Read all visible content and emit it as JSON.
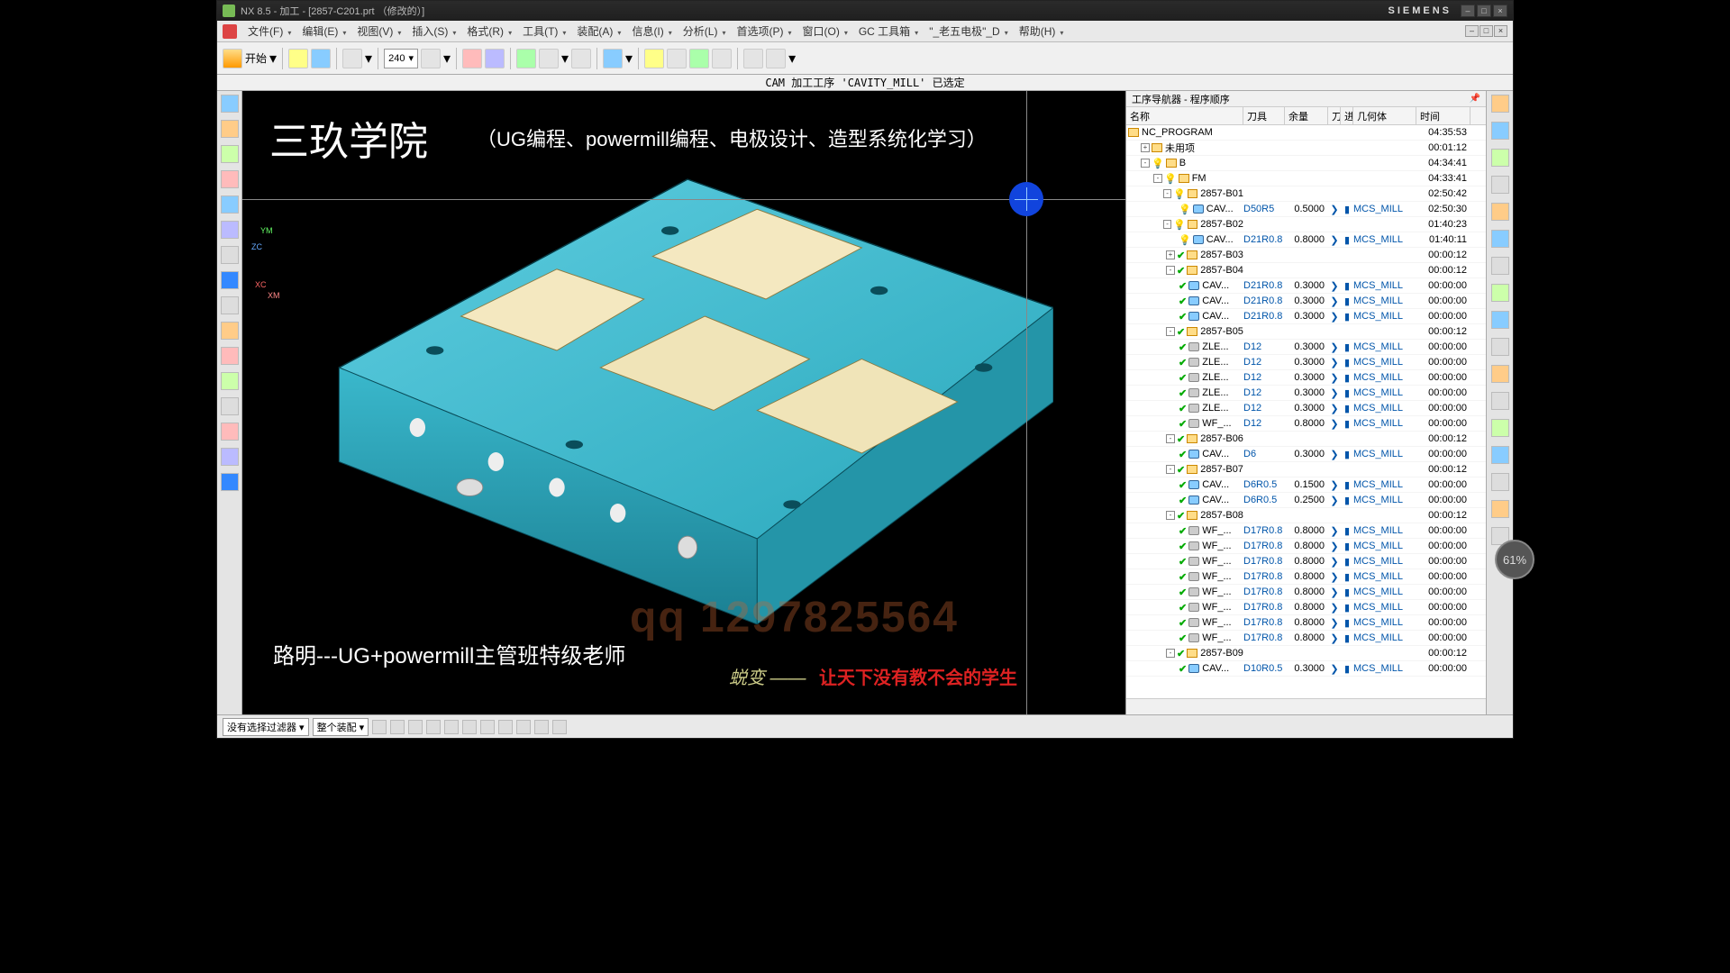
{
  "title": "NX 8.5 - 加工 - [2857-C201.prt （修改的）]",
  "brand": "SIEMENS",
  "menus": [
    "文件(F)",
    "编辑(E)",
    "视图(V)",
    "插入(S)",
    "格式(R)",
    "工具(T)",
    "装配(A)",
    "信息(I)",
    "分析(L)",
    "首选项(P)",
    "窗口(O)",
    "GC 工具箱",
    "\"_老五电极\"_D",
    "帮助(H)"
  ],
  "start_label": "开始",
  "layer_value": "240",
  "info_line": "CAM 加工工序 'CAVITY_MILL' 已选定",
  "nav": {
    "title": "工序导航器 - 程序顺序",
    "cols": {
      "name": "名称",
      "tool": "刀具",
      "rem": "余量",
      "a": "刀",
      "b": "进",
      "geom": "几何体",
      "time": "时间"
    }
  },
  "rows": [
    {
      "d": 0,
      "exp": "",
      "st": "",
      "ico": "f",
      "name": "NC_PROGRAM",
      "time": "04:35:53"
    },
    {
      "d": 1,
      "exp": "+",
      "st": "",
      "ico": "f",
      "name": "未用项",
      "time": "00:01:12"
    },
    {
      "d": 1,
      "exp": "-",
      "st": "bulb",
      "ico": "f",
      "name": "B",
      "time": "04:34:41"
    },
    {
      "d": 2,
      "exp": "-",
      "st": "bulb",
      "ico": "f",
      "name": "FM",
      "time": "04:33:41"
    },
    {
      "d": 3,
      "exp": "-",
      "st": "bulb",
      "ico": "f",
      "name": "2857-B01",
      "time": "02:50:42"
    },
    {
      "d": 4,
      "exp": "",
      "st": "bulb",
      "ico": "o",
      "name": "CAV...",
      "tool": "D50R5",
      "rem": "0.5000",
      "a": "❯",
      "b": "▮",
      "geom": "MCS_MILL",
      "time": "02:50:30"
    },
    {
      "d": 3,
      "exp": "-",
      "st": "bulb",
      "ico": "f",
      "name": "2857-B02",
      "time": "01:40:23"
    },
    {
      "d": 4,
      "exp": "",
      "st": "bulb",
      "ico": "o",
      "name": "CAV...",
      "tool": "D21R0.8",
      "rem": "0.8000",
      "a": "❯",
      "b": "▮",
      "geom": "MCS_MILL",
      "time": "01:40:11"
    },
    {
      "d": 3,
      "exp": "+",
      "st": "chk",
      "ico": "f",
      "name": "2857-B03",
      "time": "00:00:12"
    },
    {
      "d": 3,
      "exp": "-",
      "st": "chk",
      "ico": "f",
      "name": "2857-B04",
      "time": "00:00:12"
    },
    {
      "d": 4,
      "exp": "",
      "st": "chk",
      "ico": "o",
      "name": "CAV...",
      "tool": "D21R0.8",
      "rem": "0.3000",
      "a": "❯",
      "b": "▮",
      "geom": "MCS_MILL",
      "time": "00:00:00"
    },
    {
      "d": 4,
      "exp": "",
      "st": "chk",
      "ico": "o",
      "name": "CAV...",
      "tool": "D21R0.8",
      "rem": "0.3000",
      "a": "❯",
      "b": "▮",
      "geom": "MCS_MILL",
      "time": "00:00:00"
    },
    {
      "d": 4,
      "exp": "",
      "st": "chk",
      "ico": "o",
      "name": "CAV...",
      "tool": "D21R0.8",
      "rem": "0.3000",
      "a": "❯",
      "b": "▮",
      "geom": "MCS_MILL",
      "time": "00:00:00"
    },
    {
      "d": 3,
      "exp": "-",
      "st": "chk",
      "ico": "f",
      "name": "2857-B05",
      "time": "00:00:12"
    },
    {
      "d": 4,
      "exp": "",
      "st": "chk",
      "ico": "g",
      "name": "ZLE...",
      "tool": "D12",
      "rem": "0.3000",
      "a": "❯",
      "b": "▮",
      "geom": "MCS_MILL",
      "time": "00:00:00"
    },
    {
      "d": 4,
      "exp": "",
      "st": "chk",
      "ico": "g",
      "name": "ZLE...",
      "tool": "D12",
      "rem": "0.3000",
      "a": "❯",
      "b": "▮",
      "geom": "MCS_MILL",
      "time": "00:00:00"
    },
    {
      "d": 4,
      "exp": "",
      "st": "chk",
      "ico": "g",
      "name": "ZLE...",
      "tool": "D12",
      "rem": "0.3000",
      "a": "❯",
      "b": "▮",
      "geom": "MCS_MILL",
      "time": "00:00:00"
    },
    {
      "d": 4,
      "exp": "",
      "st": "chk",
      "ico": "g",
      "name": "ZLE...",
      "tool": "D12",
      "rem": "0.3000",
      "a": "❯",
      "b": "▮",
      "geom": "MCS_MILL",
      "time": "00:00:00"
    },
    {
      "d": 4,
      "exp": "",
      "st": "chk",
      "ico": "g",
      "name": "ZLE...",
      "tool": "D12",
      "rem": "0.3000",
      "a": "❯",
      "b": "▮",
      "geom": "MCS_MILL",
      "time": "00:00:00"
    },
    {
      "d": 4,
      "exp": "",
      "st": "chk",
      "ico": "g",
      "name": "WF_...",
      "tool": "D12",
      "rem": "0.8000",
      "a": "❯",
      "b": "▮",
      "geom": "MCS_MILL",
      "time": "00:00:00"
    },
    {
      "d": 3,
      "exp": "-",
      "st": "chk",
      "ico": "f",
      "name": "2857-B06",
      "time": "00:00:12"
    },
    {
      "d": 4,
      "exp": "",
      "st": "chk",
      "ico": "o",
      "name": "CAV...",
      "tool": "D6",
      "rem": "0.3000",
      "a": "❯",
      "b": "▮",
      "geom": "MCS_MILL",
      "time": "00:00:00"
    },
    {
      "d": 3,
      "exp": "-",
      "st": "chk",
      "ico": "f",
      "name": "2857-B07",
      "time": "00:00:12"
    },
    {
      "d": 4,
      "exp": "",
      "st": "chk",
      "ico": "o",
      "name": "CAV...",
      "tool": "D6R0.5",
      "rem": "0.1500",
      "a": "❯",
      "b": "▮",
      "geom": "MCS_MILL",
      "time": "00:00:00"
    },
    {
      "d": 4,
      "exp": "",
      "st": "chk",
      "ico": "o",
      "name": "CAV...",
      "tool": "D6R0.5",
      "rem": "0.2500",
      "a": "❯",
      "b": "▮",
      "geom": "MCS_MILL",
      "time": "00:00:00"
    },
    {
      "d": 3,
      "exp": "-",
      "st": "chk",
      "ico": "f",
      "name": "2857-B08",
      "time": "00:00:12"
    },
    {
      "d": 4,
      "exp": "",
      "st": "chk",
      "ico": "g",
      "name": "WF_...",
      "tool": "D17R0.8",
      "rem": "0.8000",
      "a": "❯",
      "b": "▮",
      "geom": "MCS_MILL",
      "time": "00:00:00"
    },
    {
      "d": 4,
      "exp": "",
      "st": "chk",
      "ico": "g",
      "name": "WF_...",
      "tool": "D17R0.8",
      "rem": "0.8000",
      "a": "❯",
      "b": "▮",
      "geom": "MCS_MILL",
      "time": "00:00:00"
    },
    {
      "d": 4,
      "exp": "",
      "st": "chk",
      "ico": "g",
      "name": "WF_...",
      "tool": "D17R0.8",
      "rem": "0.8000",
      "a": "❯",
      "b": "▮",
      "geom": "MCS_MILL",
      "time": "00:00:00"
    },
    {
      "d": 4,
      "exp": "",
      "st": "chk",
      "ico": "g",
      "name": "WF_...",
      "tool": "D17R0.8",
      "rem": "0.8000",
      "a": "❯",
      "b": "▮",
      "geom": "MCS_MILL",
      "time": "00:00:00"
    },
    {
      "d": 4,
      "exp": "",
      "st": "chk",
      "ico": "g",
      "name": "WF_...",
      "tool": "D17R0.8",
      "rem": "0.8000",
      "a": "❯",
      "b": "▮",
      "geom": "MCS_MILL",
      "time": "00:00:00"
    },
    {
      "d": 4,
      "exp": "",
      "st": "chk",
      "ico": "g",
      "name": "WF_...",
      "tool": "D17R0.8",
      "rem": "0.8000",
      "a": "❯",
      "b": "▮",
      "geom": "MCS_MILL",
      "time": "00:00:00"
    },
    {
      "d": 4,
      "exp": "",
      "st": "chk",
      "ico": "g",
      "name": "WF_...",
      "tool": "D17R0.8",
      "rem": "0.8000",
      "a": "❯",
      "b": "▮",
      "geom": "MCS_MILL",
      "time": "00:00:00"
    },
    {
      "d": 4,
      "exp": "",
      "st": "chk",
      "ico": "g",
      "name": "WF_...",
      "tool": "D17R0.8",
      "rem": "0.8000",
      "a": "❯",
      "b": "▮",
      "geom": "MCS_MILL",
      "time": "00:00:00"
    },
    {
      "d": 3,
      "exp": "-",
      "st": "chk",
      "ico": "f",
      "name": "2857-B09",
      "time": "00:00:12"
    },
    {
      "d": 4,
      "exp": "",
      "st": "chk",
      "ico": "o",
      "name": "CAV...",
      "tool": "D10R0.5",
      "rem": "0.3000",
      "a": "❯",
      "b": "▮",
      "geom": "MCS_MILL",
      "time": "00:00:00"
    }
  ],
  "status": {
    "filter": "没有选择过滤器",
    "asm": "整个装配"
  },
  "overlay": {
    "school": "三玖学院",
    "sub": "（UG编程、powermill编程、电极设计、造型系统化学习）",
    "teacher": "路明---UG+powermill主管班特级老师",
    "slogan1": "蜕变 ——",
    "slogan2": "让天下没有教不会的学生",
    "wm": "qq 1297825564",
    "pct": "61%"
  },
  "axes": {
    "y": "YM",
    "z": "ZC",
    "x": "XC",
    "xm": "XM"
  }
}
